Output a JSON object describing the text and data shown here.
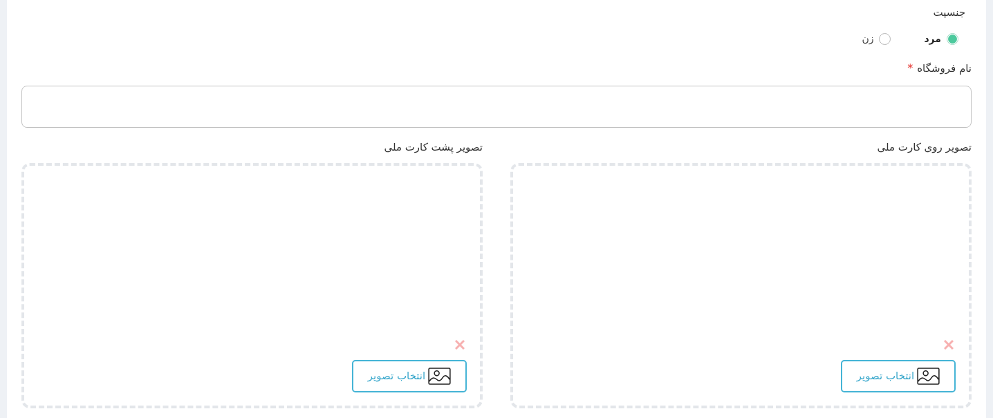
{
  "gender": {
    "label": "جنسیت",
    "options": [
      {
        "label": "مرد",
        "selected": true
      },
      {
        "label": "زن",
        "selected": false
      }
    ]
  },
  "store_name": {
    "label": "نام فروشگاه",
    "required_mark": "*"
  },
  "id_card_images": [
    {
      "label": "تصویر روی کارت ملی",
      "button": "انتخاب تصویر"
    },
    {
      "label": "تصویر پشت کارت ملی",
      "button": "انتخاب تصویر"
    }
  ]
}
